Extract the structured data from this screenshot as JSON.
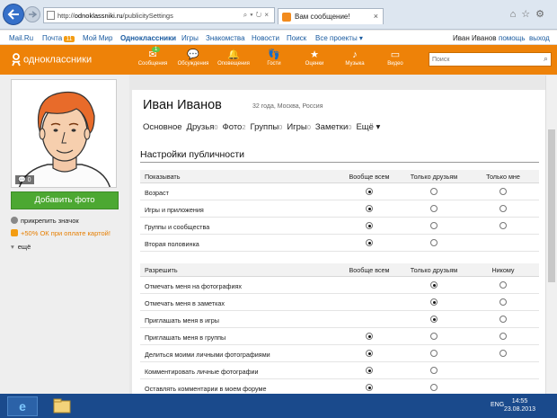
{
  "browser": {
    "url_prefix": "http://",
    "url_host": "odnoklassniki.ru",
    "url_path": "/publicitySettings",
    "tab_title": "Вам сообщение!"
  },
  "toolbar": {
    "mailru": "Mail.Ru",
    "pochta": "Почта",
    "pochta_count": "11",
    "moy_mir": "Мой Мир",
    "ok": "Одноклассники",
    "igry": "Игры",
    "znakomstva": "Знакомства",
    "novosti": "Новости",
    "poisk": "Поиск",
    "all_projects": "Все проекты ▾",
    "user": "Иван Иванов",
    "help": "помощь",
    "exit": "выход"
  },
  "okheader": {
    "logo": "одноклассники",
    "nav": [
      {
        "label": "Сообщения",
        "icon": "envelope-icon",
        "glyph": "✉",
        "count": "1"
      },
      {
        "label": "Обсуждения",
        "icon": "chat-icon",
        "glyph": "💬",
        "count": ""
      },
      {
        "label": "Оповещения",
        "icon": "bell-icon",
        "glyph": "🔔",
        "count": ""
      },
      {
        "label": "Гости",
        "icon": "footprints-icon",
        "glyph": "👣",
        "count": ""
      },
      {
        "label": "Оценки",
        "icon": "star-icon",
        "glyph": "★",
        "count": ""
      },
      {
        "label": "Музыка",
        "icon": "music-icon",
        "glyph": "♪",
        "count": ""
      },
      {
        "label": "Видео",
        "icon": "video-icon",
        "glyph": "▭",
        "count": ""
      }
    ],
    "search_placeholder": "Поиск"
  },
  "sidebar": {
    "photo_comments": "0",
    "add_photo": "Добавить фото",
    "pin_badge": "прикрепить значок",
    "promo": "+50% ОК при оплате картой!",
    "more": "ещё"
  },
  "profile": {
    "name": "Иван Иванов",
    "info": "32 года, Москва, Россия",
    "tabs": [
      {
        "label": "Основное",
        "count": ""
      },
      {
        "label": "Друзья",
        "count": "0"
      },
      {
        "label": "Фото",
        "count": "2"
      },
      {
        "label": "Группы",
        "count": "0"
      },
      {
        "label": "Игры",
        "count": "0"
      },
      {
        "label": "Заметки",
        "count": "0"
      },
      {
        "label": "Ещё ▾",
        "count": ""
      }
    ]
  },
  "settings": {
    "title": "Настройки публичности",
    "show": {
      "header": [
        "Показывать",
        "Вообще всем",
        "Только друзьям",
        "Только мне"
      ],
      "rows": [
        {
          "label": "Возраст",
          "choice": 0,
          "options": 3
        },
        {
          "label": "Игры и приложения",
          "choice": 0,
          "options": 3
        },
        {
          "label": "Группы и сообщества",
          "choice": 0,
          "options": 3
        },
        {
          "label": "Вторая половинка",
          "choice": 0,
          "options": 2
        }
      ]
    },
    "allow": {
      "header": [
        "Разрешить",
        "Вообще всем",
        "Только друзьям",
        "Никому"
      ],
      "rows": [
        {
          "label": "Отмечать меня на фотографиях",
          "choice": 1,
          "options": 3,
          "skip_first": true
        },
        {
          "label": "Отмечать меня в заметках",
          "choice": 1,
          "options": 3,
          "skip_first": true
        },
        {
          "label": "Приглашать меня в игры",
          "choice": 1,
          "options": 3,
          "skip_first": true
        },
        {
          "label": "Приглашать меня в группы",
          "choice": 0,
          "options": 3
        },
        {
          "label": "Делиться моими личными фотографиями",
          "choice": 0,
          "options": 3
        },
        {
          "label": "Комментировать личные фотографии",
          "choice": 0,
          "options": 2
        },
        {
          "label": "Оставлять комментарии в моем форуме",
          "choice": 0,
          "options": 2
        }
      ]
    }
  },
  "taskbar": {
    "lang": "ENG",
    "time": "14:55",
    "date": "23.08.2013"
  }
}
